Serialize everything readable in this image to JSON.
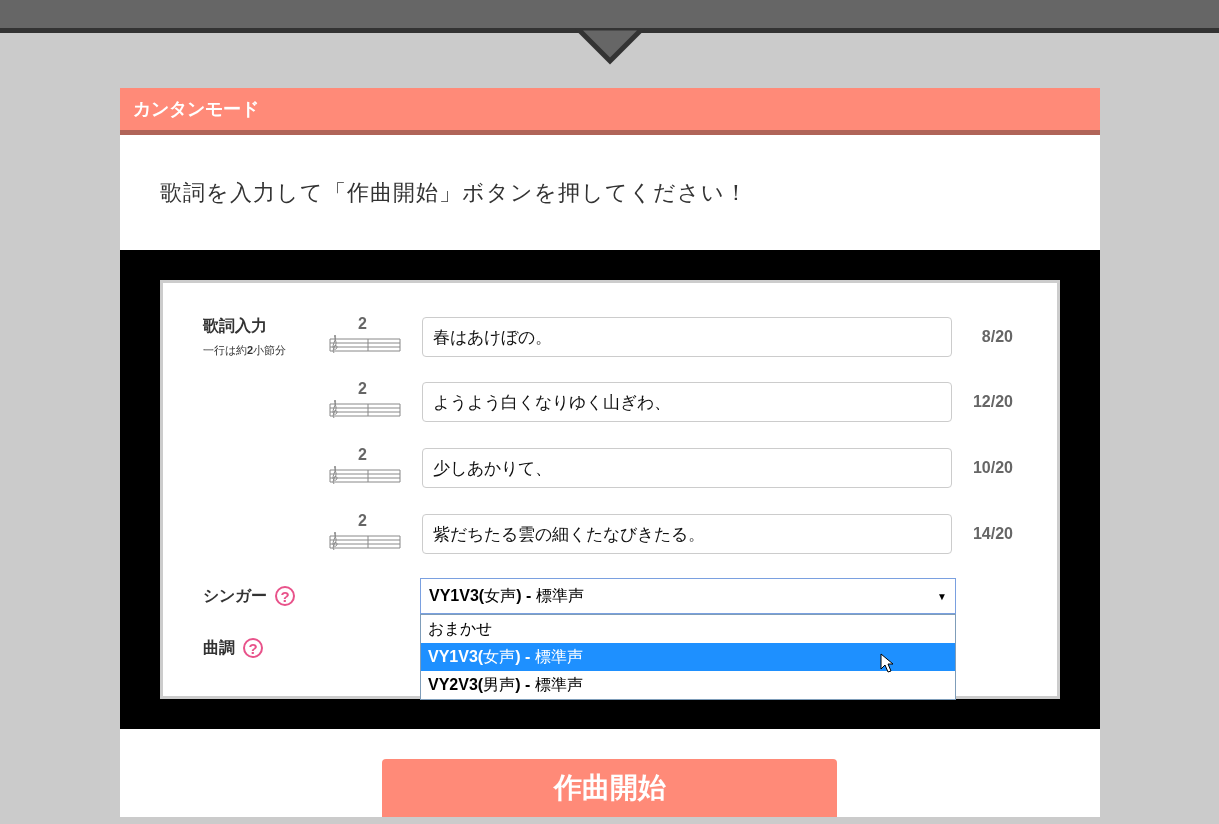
{
  "mode_panel": {
    "title": "カンタンモード",
    "instruction": "歌詞を入力して「作曲開始」ボタンを押してください！",
    "lyrics": {
      "label": "歌詞入力",
      "hint": "一行は約**2**小節分",
      "lines": [
        {
          "measures": "2",
          "value": "春はあけぼの。",
          "count": "8/20"
        },
        {
          "measures": "2",
          "value": "ようよう白くなりゆく山ぎわ、",
          "count": "12/20"
        },
        {
          "measures": "2",
          "value": "少しあかりて、",
          "count": "10/20"
        },
        {
          "measures": "2",
          "value": "紫だちたる雲の細くたなびきたる。",
          "count": "14/20"
        }
      ]
    },
    "singer": {
      "label": "シンガー",
      "help": "?",
      "value": "**VY1V3(**女声**) -** 標準声",
      "caret": "▼",
      "expanded": true,
      "options": [
        {
          "label": "おまかせ",
          "selected": false
        },
        {
          "label": "**VY1V3(**女声**) -** 標準声",
          "selected": true
        },
        {
          "label": "**VY2V3(**男声**) -** 標準声",
          "selected": false
        }
      ]
    },
    "tune": {
      "label": "曲調",
      "help": "?"
    },
    "start_button": "作曲開始"
  }
}
